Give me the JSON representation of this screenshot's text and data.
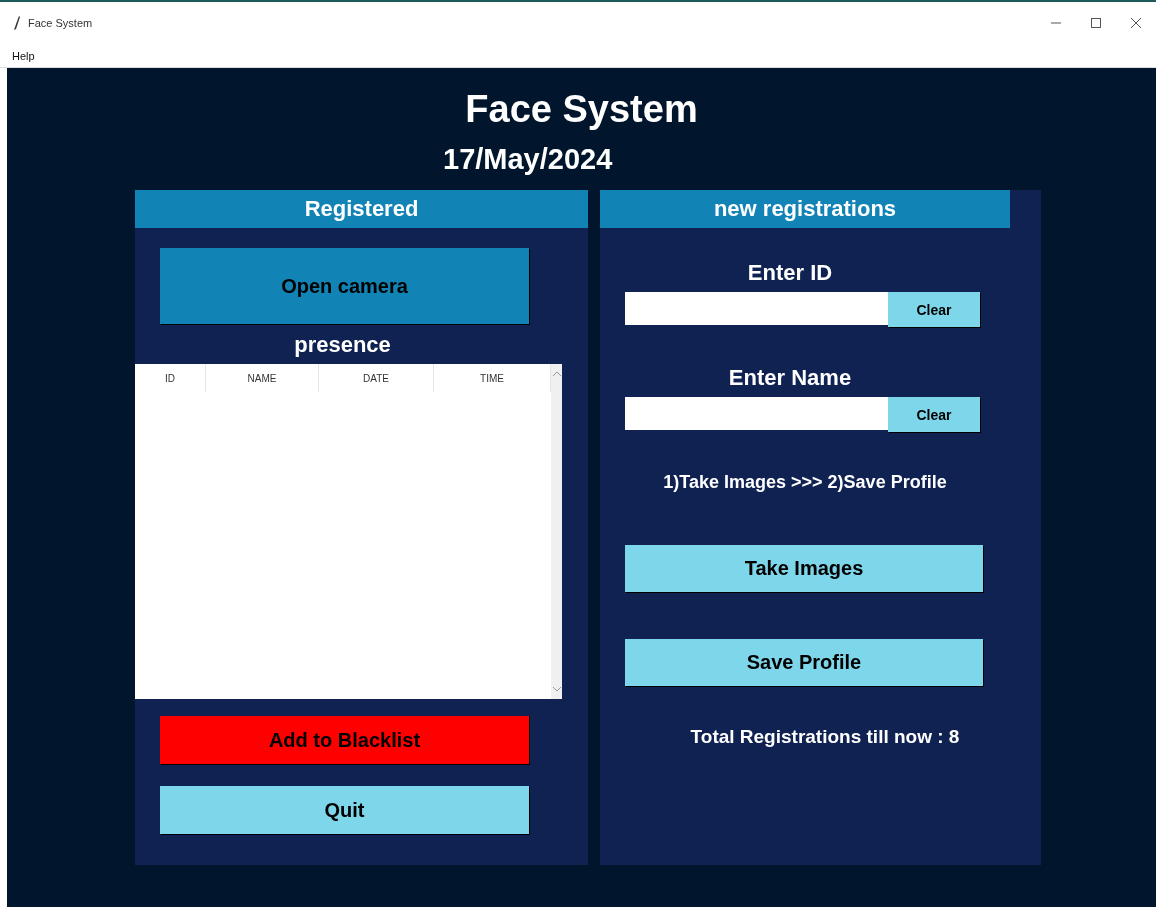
{
  "window": {
    "title": "Face System"
  },
  "menu": [
    "Help"
  ],
  "header": {
    "title": "Face System",
    "date": "17/May/2024"
  },
  "left_panel": {
    "title": "Registered",
    "open_camera": "Open camera",
    "table_title": "presence",
    "table": {
      "columns": [
        "ID",
        "NAME",
        "DATE",
        "TIME"
      ]
    },
    "blacklist_button": "Add to Blacklist",
    "quit_button": "Quit"
  },
  "right_panel": {
    "title": "new registrations",
    "fields": [
      {
        "label": "Enter ID",
        "clear": "Clear"
      },
      {
        "label": "Enter Name",
        "clear": "Clear"
      }
    ],
    "instructions": "1)Take Images  >>>  2)Save Profile",
    "take_images": "Take Images",
    "save_profile": "Save Profile",
    "total": "Total Registrations till now  : 8"
  }
}
